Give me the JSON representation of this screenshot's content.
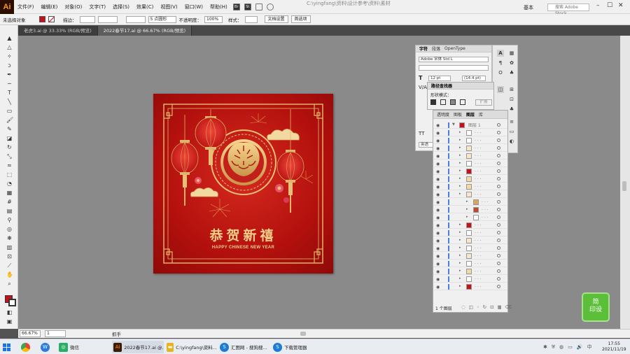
{
  "app": {
    "logo": "Ai",
    "title_ghost": "C:\\yingfang\\资料\\设计参考\\资料\\素材",
    "workspace": "基本",
    "stock_search_placeholder": "搜索 Adobe Stock"
  },
  "menu": [
    "文件(F)",
    "编辑(E)",
    "对象(O)",
    "文字(T)",
    "选择(S)",
    "效果(C)",
    "视图(V)",
    "窗口(W)",
    "帮助(H)"
  ],
  "menu_icons": [
    "Br",
    "St"
  ],
  "control_bar": {
    "no_selection": "未选择对象",
    "stroke_label": "描边：",
    "point_style": "5 点圆形",
    "opacity_label": "不透明度：",
    "opacity_value": "100%",
    "style_label": "样式：",
    "doc_setup": "文档设置",
    "prefs": "首选项"
  },
  "tabs": [
    {
      "label": "老虎3.ai @ 33.33% (RGB/预览)",
      "active": false
    },
    {
      "label": "2022春节17.ai @ 66.67% (RGB/预览)",
      "active": true
    }
  ],
  "artboard": {
    "title": "恭贺新禧",
    "subtitle": "HAPPY CHINESE NEW YEAR"
  },
  "char_panel": {
    "tabs": [
      "字符",
      "段落",
      "OpenType"
    ],
    "font_family": "Adobe 宋体 Std L",
    "font_size": "12 pt",
    "leading": "(14.4 pt)",
    "lang": "英语"
  },
  "path_panel": {
    "title": "路径查找器",
    "shape_modes": "形状模式：",
    "expand_button": "扩展"
  },
  "layers_panel": {
    "tabs": [
      "透明度",
      "图板",
      "图层",
      "库"
    ],
    "layer_name": "图层 1",
    "footer": "1 个图层",
    "rows": 21
  },
  "statusbar": {
    "zoom": "66.67%",
    "artboard_nav": "1",
    "tool": "抓手"
  },
  "taskbar": {
    "items": [
      {
        "label": "微信",
        "color": "#2aae67"
      },
      {
        "label": "2022春节17.ai @...",
        "color": "#3d1a00"
      },
      {
        "label": "C:\\yingfang\\资料...",
        "color": "#e6b422"
      },
      {
        "label": "汇图网 - 搜狗搜...",
        "color": "#1d7bd8"
      },
      {
        "label": "下载管理器",
        "color": "#1d7bd8"
      }
    ],
    "time": "17:55",
    "date": "2021/11/19"
  },
  "watermark": "简\n印设"
}
